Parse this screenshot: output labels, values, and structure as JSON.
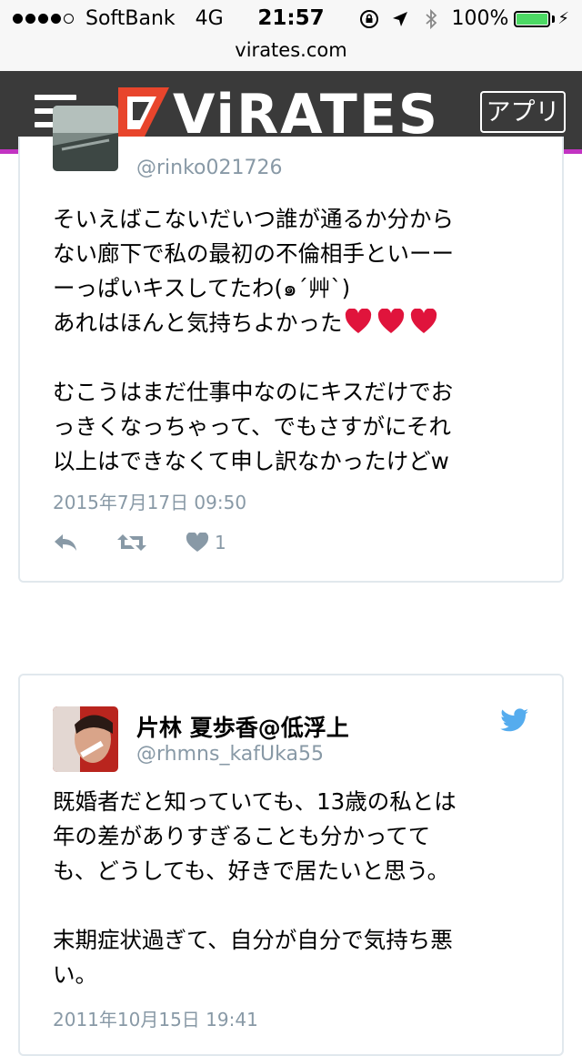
{
  "status_bar": {
    "carrier": "SoftBank",
    "network": "4G",
    "time": "21:57",
    "battery": "100%",
    "battery_level": 1.0,
    "icons": [
      "signal-dots-icon",
      "orientation-lock-icon",
      "location-arrow-icon",
      "bluetooth-icon",
      "battery-icon",
      "charging-bolt-icon"
    ]
  },
  "url_bar": {
    "url": "virates.com"
  },
  "header": {
    "logo_text": "ViRATES",
    "app_button": "アプリ",
    "menu_icon": "hamburger-menu-icon",
    "bg_color": "#3a3a3a",
    "accent_color": "#c233c2"
  },
  "tweets": [
    {
      "handle": "@rinko021726",
      "text_line1": "そいえばこないだいつ誰が通るか分から\nない廊下で私の最初の不倫相手といーー\nーっぱいキスしてたわ(๑´艸`)\nあれはほんと気持ちよかった",
      "text_line2": "\n\nむこうはまだ仕事中なのにキスだけでお\nっきくなっちゃって、でもさすがにそれ\n以上はできなくて申し訳なかったけどw",
      "emoji": [
        "heart",
        "heart",
        "heart"
      ],
      "date": "2015年7月17日 09:50",
      "like_count": "1",
      "icons": [
        "reply-icon",
        "retweet-icon",
        "like-heart-icon"
      ]
    },
    {
      "name": "片林 夏歩香@低浮上",
      "handle": "@rhmns_kafUka55",
      "text": "既婚者だと知っていても、13歳の私とは\n年の差がありすぎることも分かってて\nも、どうしても、好きで居たいと思う。\n\n末期症状過ぎて、自分が自分で気持ち悪\nい。",
      "date": "2011年10月15日 19:41",
      "icons": [
        "twitter-bird-icon"
      ]
    }
  ],
  "colors": {
    "link_gray": "#8899a6",
    "twitter_blue": "#55acee",
    "heart_red": "#e0143c",
    "card_border": "#e1e8ed"
  }
}
